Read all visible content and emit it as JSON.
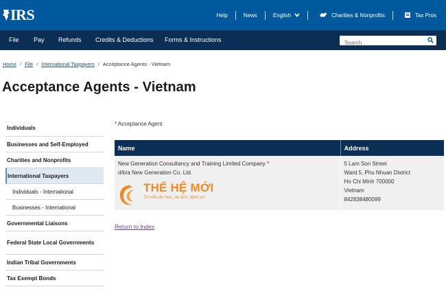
{
  "header": {
    "logo_text": "IRS",
    "links": [
      {
        "label": "Help"
      },
      {
        "label": "News"
      },
      {
        "label": "English"
      },
      {
        "label": "Charities & Nonprofits"
      },
      {
        "label": "Tax Pros"
      }
    ],
    "brand_color": "#00599c"
  },
  "nav": {
    "items": [
      "File",
      "Pay",
      "Refunds",
      "Credits & Deductions",
      "Forms & Instructions"
    ],
    "search_placeholder": "Search",
    "color": "#0b2e54"
  },
  "breadcrumb": {
    "items": [
      "Home",
      "File",
      "International Taxpayers"
    ],
    "current": "Acceptance Agents - Vietnam"
  },
  "page": {
    "title": "Acceptance Agents - Vietnam",
    "note": "* Acceptance Agent",
    "return_link": "Return to Index"
  },
  "sidebar": {
    "items": [
      {
        "label": "Individuals"
      },
      {
        "label": "Businesses and Self-Employed"
      },
      {
        "label": "Charities and Nonprofits"
      },
      {
        "label": "International Taxpayers",
        "active": true
      },
      {
        "label": "Individuals - International"
      },
      {
        "label": "Businesses - International"
      },
      {
        "label": "Governmental Liaisons"
      },
      {
        "label": "Federal State Local Governments"
      },
      {
        "label": "Indian Tribal Governments"
      },
      {
        "label": "Tax Exempt Bonds"
      }
    ]
  },
  "table": {
    "headers": [
      "Name",
      "Address"
    ],
    "row": {
      "name_line1": "New Generation Consultancy and Training Limited Company *",
      "name_line2": "d/b/a New Generation Co. Ltd.",
      "brand_name": "THẾ HỆ MỚI",
      "brand_tagline": "Tư vấn du học, du lịch, định cư",
      "address": [
        "5 Lam Son Street",
        "Ward 5, Phu Nhuan District",
        "Ho Chi Minh 700000",
        "Vietnam",
        "842838480099"
      ]
    }
  }
}
